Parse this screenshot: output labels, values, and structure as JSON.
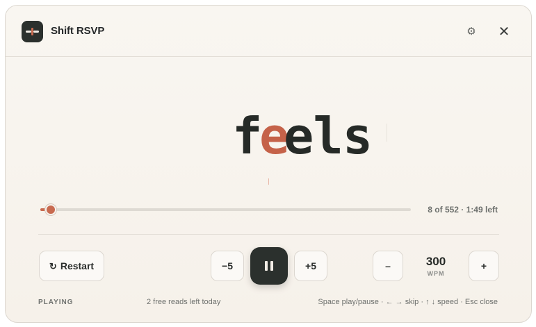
{
  "app": {
    "title": "Shift RSVP"
  },
  "header": {
    "settings_icon": "gear-icon",
    "close_icon": "close-icon"
  },
  "reader": {
    "word_before": "f",
    "word_focus": "e",
    "word_after": "els",
    "focus_color": "#c56249"
  },
  "progress": {
    "current_word": 8,
    "total_words": 552,
    "fraction": 0.0145,
    "label": "8 of 552 · 1:49 left"
  },
  "controls": {
    "restart_icon": "↻",
    "restart_label": "Restart",
    "skip_back_label": "−5",
    "skip_forward_label": "+5",
    "play_state_icon": "pause-icon",
    "speed_down_label": "–",
    "speed_up_label": "+",
    "wpm_value": "300",
    "wpm_unit": "WPM"
  },
  "footer": {
    "state": "PLAYING",
    "reads_left": "2 free reads left today",
    "shortcuts": "Space play/pause · ← → skip · ↑ ↓ speed · Esc close"
  },
  "colors": {
    "accent": "#c86a4f",
    "dark": "#2b302d",
    "background": "#f8f4ee"
  }
}
